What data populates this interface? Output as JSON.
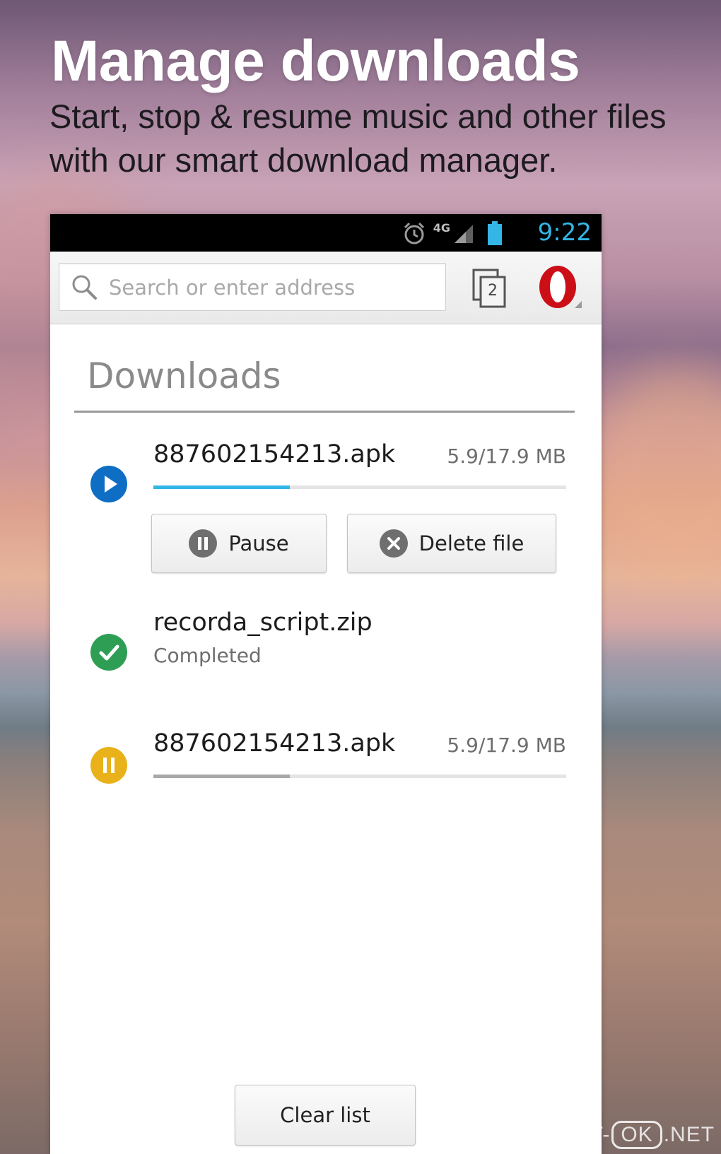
{
  "hero": {
    "title": "Manage downloads",
    "subtitle": "Start, stop & resume music and other files with our smart download manager."
  },
  "statusbar": {
    "time": "9:22",
    "network": "4G",
    "icons": [
      "alarm-icon",
      "signal-icon",
      "battery-icon"
    ]
  },
  "toolbar": {
    "search_placeholder": "Search or enter address",
    "tab_count": "2",
    "menu_icon": "opera-logo-icon"
  },
  "downloads": {
    "heading": "Downloads",
    "items": [
      {
        "filename": "887602154213.apk",
        "size": "5.9/17.9 MB",
        "state": "downloading",
        "progress": 0.33,
        "icon": "play-icon",
        "color": "#0d6ec4",
        "actions": {
          "pause_label": "Pause",
          "delete_label": "Delete file"
        }
      },
      {
        "filename": "recorda_script.zip",
        "status_text": "Completed",
        "state": "completed",
        "icon": "check-icon",
        "color": "#2f9e55"
      },
      {
        "filename": "887602154213.apk",
        "size": "5.9/17.9 MB",
        "state": "paused",
        "progress": 0.33,
        "icon": "pause-icon",
        "color": "#e9b21a"
      }
    ],
    "clear_label": "Clear list"
  },
  "colors": {
    "progress_active": "#33b5e5",
    "progress_paused": "#a8a8a8",
    "opera_red": "#cc0f16",
    "status_time": "#33b5e5"
  },
  "watermark": {
    "prefix": "SOFT-",
    "mark": "OK",
    "suffix": ".NET"
  }
}
